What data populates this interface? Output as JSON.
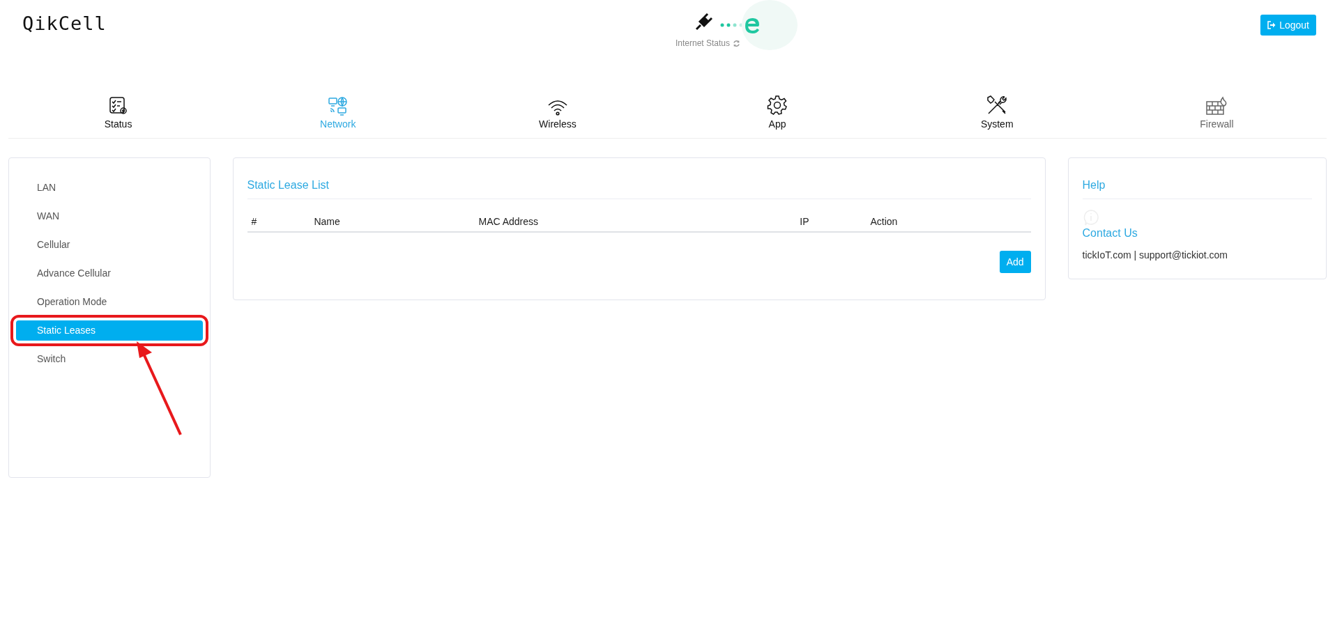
{
  "logo": "QikCell",
  "internet_status": {
    "label": "Internet Status"
  },
  "logout": "Logout",
  "nav": [
    {
      "label": "Status",
      "selected": false,
      "disabled": false,
      "kind": "status"
    },
    {
      "label": "Network",
      "selected": true,
      "disabled": false,
      "kind": "network"
    },
    {
      "label": "Wireless",
      "selected": false,
      "disabled": false,
      "kind": "wireless"
    },
    {
      "label": "App",
      "selected": false,
      "disabled": false,
      "kind": "app"
    },
    {
      "label": "System",
      "selected": false,
      "disabled": false,
      "kind": "system"
    },
    {
      "label": "Firewall",
      "selected": false,
      "disabled": true,
      "kind": "firewall"
    }
  ],
  "sidebar": {
    "items": [
      {
        "label": "LAN",
        "selected": false
      },
      {
        "label": "WAN",
        "selected": false
      },
      {
        "label": "Cellular",
        "selected": false
      },
      {
        "label": "Advance Cellular",
        "selected": false
      },
      {
        "label": "Operation Mode",
        "selected": false
      },
      {
        "label": "Static Leases",
        "selected": true
      },
      {
        "label": "Switch",
        "selected": false
      }
    ]
  },
  "main": {
    "title": "Static Lease List",
    "table": {
      "columns": [
        "#",
        "Name",
        "MAC Address",
        "IP",
        "Action"
      ]
    },
    "add_button": "Add"
  },
  "help": {
    "title": "Help",
    "contact_title": "Contact Us",
    "contact_text": "tickIoT.com | support@tickiot.com"
  }
}
